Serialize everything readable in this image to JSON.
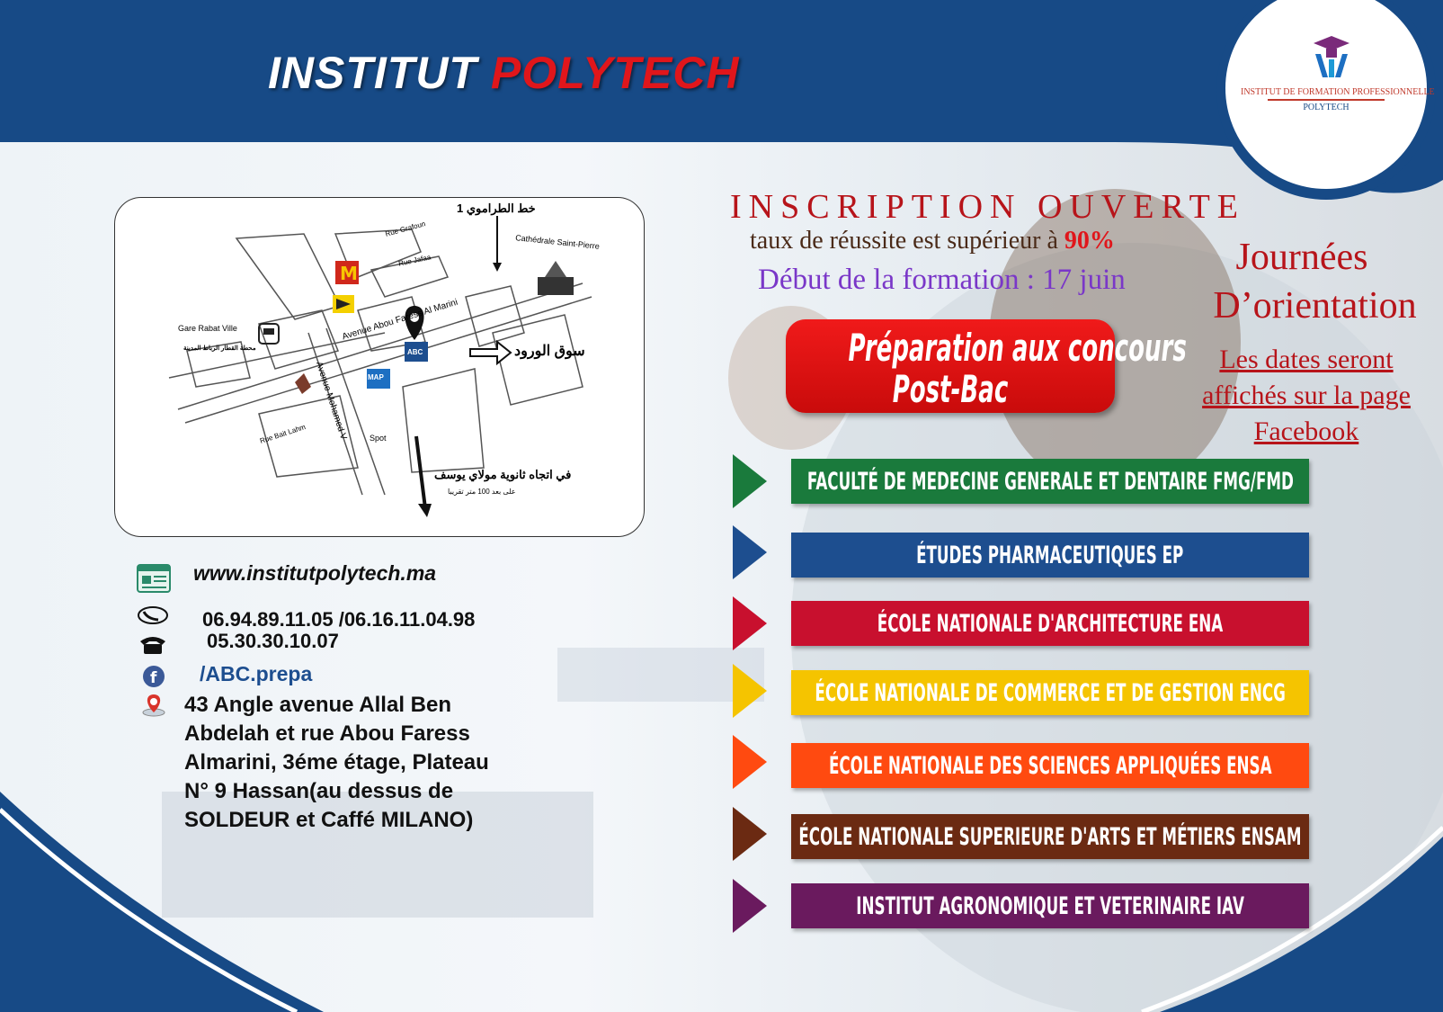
{
  "header": {
    "brand_part1": "INSTITUT",
    "brand_part2": "POLYTECH",
    "logo_line1": "INSTITUT DE FORMATION PROFESSIONNELLE",
    "logo_line2": "POLYTECH"
  },
  "inscription": {
    "title": "INSCRIPTION OUVERTE",
    "rate_text": "taux de réussite est supérieur à ",
    "rate_value": "90%",
    "start_text": "Début de la formation : 17 juin"
  },
  "prep_button": {
    "line1": "Préparation aux concours",
    "line2": "Post-Bac"
  },
  "orientation": {
    "title1": "Journées",
    "title2": "D’orientation",
    "note_line1": "Les dates seront",
    "note_line2": "affichés sur la page",
    "note_line3": "Facebook"
  },
  "schools": [
    {
      "label": "FACULTÉ DE MEDECINE GENERALE ET DENTAIRE  FMG/FMD",
      "color": "#1a7a3c"
    },
    {
      "label": "ÉTUDES PHARMACEUTIQUES  EP",
      "color": "#1d4e8f"
    },
    {
      "label": "ÉCOLE NATIONALE D'ARCHITECTURE  ENA",
      "color": "#c8102e"
    },
    {
      "label": "ÉCOLE NATIONALE DE COMMERCE ET DE GESTION  ENCG",
      "color": "#f5c400"
    },
    {
      "label": "ÉCOLE NATIONALE DES SCIENCES APPLIQUÉES  ENSA",
      "color": "#ff4a10"
    },
    {
      "label": "ÉCOLE NATIONALE SUPERIEURE D'ARTS ET MÉTIERS  ENSAM",
      "color": "#6b2a12"
    },
    {
      "label": "INSTITUT AGRONOMIQUE ET VETERINAIRE  IAV",
      "color": "#6a1a5e"
    }
  ],
  "map": {
    "tram": "خط الطراموي 1",
    "rue_grafoun": "Rue Grafoun",
    "cathedrale": "Cathédrale Saint-Pierre",
    "rue_jafaa": "Rue Jafaa",
    "gare": "Gare Rabat Ville",
    "gare_ar": "محطة القطار الرباط المدينة",
    "avenue_abou": "Avenue Abou Faress Al Marini",
    "avenue_mohamed": "Avenue Mohamed V",
    "rue_bait": "Rue Bait Lahm",
    "spot": "Spot",
    "souk": "سوق الورود",
    "direction_ar": "في اتجاه ثانوية مولاي يوسف",
    "distance_ar": "على بعد 100 متر تقريبا",
    "map_logo": "MAP",
    "abc_logo": "ABC"
  },
  "contact": {
    "website": "www.institutpolytech.ma",
    "mobiles": "06.94.89.11.05 /06.16.11.04.98",
    "landline": "05.30.30.10.07",
    "facebook": "/ABC.prepa",
    "address_line1": "43 Angle avenue Allal Ben",
    "address_line2": "Abdelah et rue Abou Faress",
    "address_line3": "Almarini, 3éme étage, Plateau",
    "address_line4": "N° 9 Hassan(au dessus de",
    "address_line5": "SOLDEUR et Caffé MILANO)"
  },
  "colors": {
    "navy": "#174a86",
    "red": "#e0161b",
    "purple": "#7a37c8",
    "dark_red": "#b7141a"
  }
}
